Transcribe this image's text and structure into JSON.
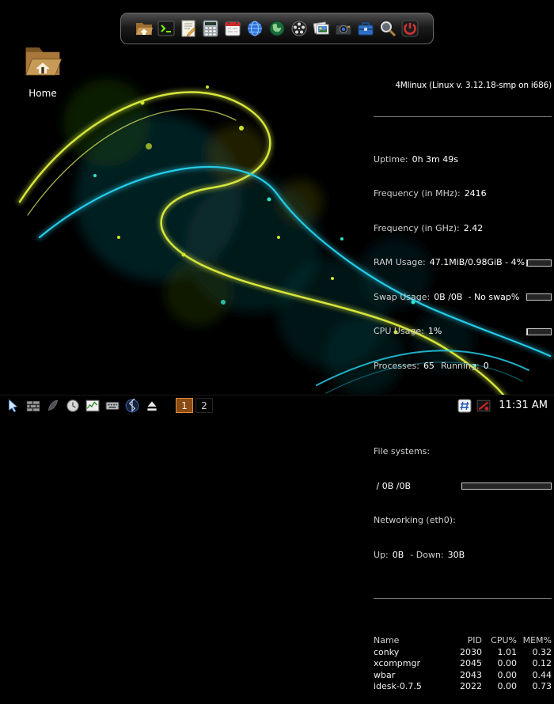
{
  "desktop": {
    "home_label": "Home"
  },
  "dock": {
    "icons": [
      "file-manager",
      "terminal",
      "text-editor",
      "calculator",
      "calendar",
      "web-browser",
      "network-globe",
      "media-player",
      "image-viewer",
      "camera",
      "archive-manager",
      "search",
      "quit"
    ]
  },
  "conky": {
    "title": "4Mlinux (Linux v. 3.12.18-smp on i686)",
    "uptime": {
      "label": "Uptime:",
      "value": "0h 3m 49s"
    },
    "freq_mhz": {
      "label": "Frequency (in MHz):",
      "value": "2416"
    },
    "freq_ghz": {
      "label": "Frequency (in GHz):",
      "value": "2.42"
    },
    "ram": {
      "label": "RAM Usage:",
      "value": "47.1MiB/0.98GiB - 4%",
      "percent": 4
    },
    "swap": {
      "label": "Swap Usage:",
      "value": "0B /0B  - No swap%",
      "percent": 0
    },
    "cpu": {
      "label": "CPU Usage:",
      "value": "1%",
      "percent": 1
    },
    "processes": {
      "label": "Processes:",
      "value": "65",
      "running_label": "Running:",
      "running_value": "0"
    },
    "fs_header": "File systems:",
    "fs": {
      "label": " / 0B /0B",
      "percent": 0
    },
    "net_header": "Networking (eth0):",
    "net": {
      "up_label": "Up:",
      "up_value": "0B",
      "down_label": "- Down:",
      "down_value": "30B"
    },
    "table": {
      "headers": [
        "Name",
        "PID",
        "CPU%",
        "MEM%"
      ],
      "rows": [
        {
          "name": "conky",
          "pid": "2030",
          "cpu": "1.01",
          "mem": "0.32"
        },
        {
          "name": "xcompmgr",
          "pid": "2045",
          "cpu": "0.00",
          "mem": "0.12"
        },
        {
          "name": "wbar",
          "pid": "2043",
          "cpu": "0.00",
          "mem": "0.44"
        },
        {
          "name": "idesk-0.7.5",
          "pid": "2022",
          "cpu": "0.00",
          "mem": "0.73"
        }
      ]
    }
  },
  "taskbar": {
    "tray_icons": [
      "mouse-config",
      "firewall",
      "dock-config",
      "clock",
      "system-monitor",
      "keyboard",
      "bluetooth",
      "eject"
    ],
    "workspaces": [
      "1",
      "2"
    ],
    "right_icons": [
      "hash-app",
      "recorder"
    ],
    "clock": "11:31 AM"
  }
}
